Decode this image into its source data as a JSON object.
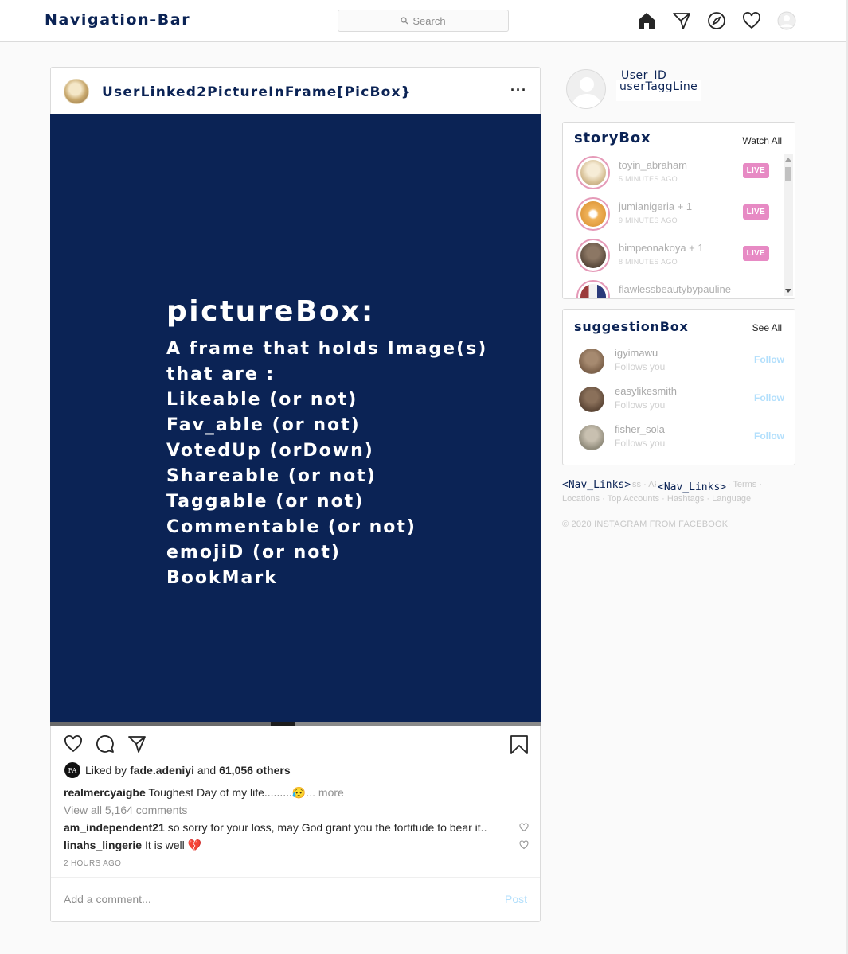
{
  "nav": {
    "brand": "Navigation-Bar",
    "search_placeholder": "Search",
    "icons": [
      "home-icon",
      "direct-icon",
      "explore-icon",
      "activity-icon",
      "profile-icon"
    ]
  },
  "post": {
    "username": "UserLinked2PictureInFrame[PicBox}",
    "more": "···",
    "picture_title": "pictureBox:",
    "picture_lines": [
      "A frame that holds Image(s)",
      "that are :",
      "Likeable (or not)",
      "Fav_able (or not)",
      "VotedUp (orDown)",
      "Shareable (or not)",
      "Taggable (or not)",
      "Commentable (or not)",
      "emojiD (or not)",
      "BookMark"
    ],
    "liked_avatar_text": "FA",
    "liked_prefix": "Liked by",
    "liked_user": "fade.adeniyi",
    "liked_and": "and",
    "liked_others": "61,056 others",
    "caption_user": "realmercyaigbe",
    "caption_text": "Toughest Day of my life.........",
    "caption_emoji": "😥",
    "caption_more": "... more",
    "view_all": "View all 5,164 comments",
    "comments": [
      {
        "user": "am_independent21",
        "text": "so sorry for your loss, may God grant you the fortitude to bear it..",
        "emoji": ""
      },
      {
        "user": "linahs_lingerie",
        "text": "It is well",
        "emoji": "💔"
      }
    ],
    "time_ago": "2 HOURS AGO",
    "add_comment_placeholder": "Add a comment...",
    "post_button": "Post"
  },
  "me": {
    "user_id": "User_ID",
    "tagline": "userTaggLine"
  },
  "story_box": {
    "title": "storyBox",
    "link": "Watch All",
    "items": [
      {
        "name": "toyin_abraham",
        "time": "5 MINUTES AGO",
        "badge": "LIVE",
        "color": "#d9c39a"
      },
      {
        "name": "jumianigeria + 1",
        "time": "9 MINUTES AGO",
        "badge": "LIVE",
        "color": "#f0b35a"
      },
      {
        "name": "bimpeonakoya + 1",
        "time": "8 MINUTES AGO",
        "badge": "LIVE",
        "color": "#6b5a4a"
      },
      {
        "name": "flawlessbeautybypauline",
        "time": "",
        "badge": "",
        "color": "#9b3b3b"
      }
    ]
  },
  "suggestion_box": {
    "title": "suggestionBox",
    "link": "See All",
    "items": [
      {
        "name": "igyimawu",
        "sub": "Follows you",
        "action": "Follow",
        "color": "#7a5f48"
      },
      {
        "name": "easylikesmith",
        "sub": "Follows you",
        "action": "Follow",
        "color": "#5c4636"
      },
      {
        "name": "fisher_sola",
        "sub": "Follows you",
        "action": "Follow",
        "color": "#8f8a7a"
      }
    ]
  },
  "footer": {
    "nav_link_a": "<Nav_Links>",
    "nav_link_b": "<Nav_Links>",
    "links_line1": "About · Help · Press · API · Jobs · Privacy · Terms ·",
    "links_line2": "Locations · Top Accounts · Hashtags · Language",
    "copyright": "© 2020 INSTAGRAM FROM FACEBOOK"
  }
}
